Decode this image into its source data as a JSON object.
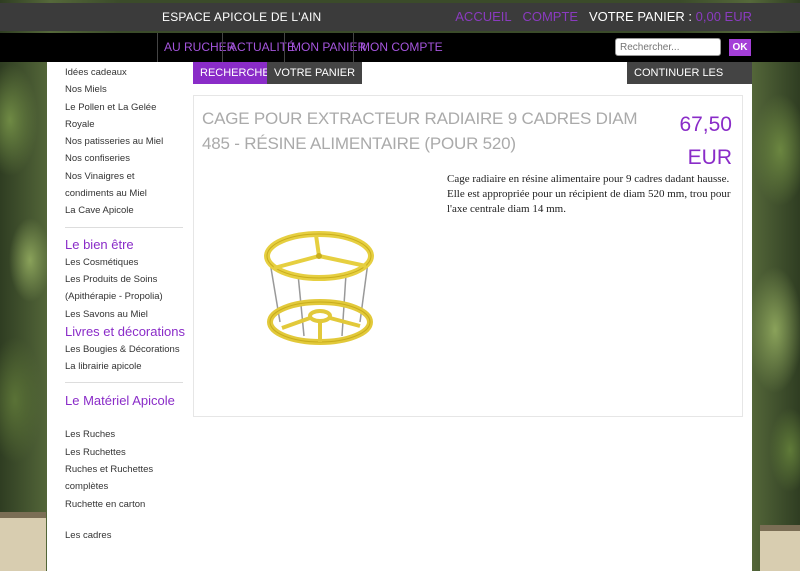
{
  "header": {
    "site_title": "ESPACE APICOLE DE L'AIN",
    "links": {
      "accueil": "ACCUEIL",
      "compte": "COMPTE",
      "panier_label": "VOTRE PANIER :",
      "panier_amount": "0,00 EUR"
    }
  },
  "nav": {
    "items": [
      "AU RUCHER",
      "ACTUALITÉ",
      "MON PANIER",
      "MON COMPTE"
    ],
    "search_placeholder": "Rechercher...",
    "ok": "OK"
  },
  "sidebar": {
    "group1": [
      "Idées cadeaux",
      "Nos Miels",
      "Le Pollen et La Gelée",
      "Royale",
      "Nos patisseries au Miel",
      "Nos confiseries",
      "Nos Vinaigres et",
      "condiments au Miel",
      "La Cave Apicole"
    ],
    "head_bien_etre": "Le bien être",
    "group2": [
      "Les Cosmétiques",
      "Les Produits de Soins",
      "(Apithérapie - Propolia)",
      "Les Savons au Miel"
    ],
    "head_livres": "Livres et décorations",
    "group3": [
      "Les Bougies & Décorations",
      "La librairie apicole"
    ],
    "head_materiel": "Le Matériel Apicole",
    "group4": [
      "Les Ruches",
      "Les Ruchettes",
      "Ruches et Ruchettes",
      "complètes",
      "Ruchette en carton"
    ],
    "group5": [
      "Les cadres"
    ]
  },
  "actions": {
    "rechercher": "RECHERCHER",
    "votre_panier": "VOTRE PANIER",
    "continuer": "CONTINUER LES ACHATS"
  },
  "product": {
    "title": "CAGE POUR EXTRACTEUR RADIAIRE 9 CADRES DIAM 485 - RÉSINE ALIMENTAIRE (POUR 520)",
    "price_value": "67,50",
    "price_currency": "EUR",
    "description": "Cage radiaire en résine  alimentaire pour 9 cadres dadant hausse. Elle est appropriée pour un récipient de diam 520 mm, trou pour l'axe centrale diam 14 mm.",
    "image_icon": "extractor-cage-image"
  },
  "colors": {
    "accent": "#8a2cc8",
    "topbar": "#3b3b3b",
    "navbar": "#000000"
  }
}
